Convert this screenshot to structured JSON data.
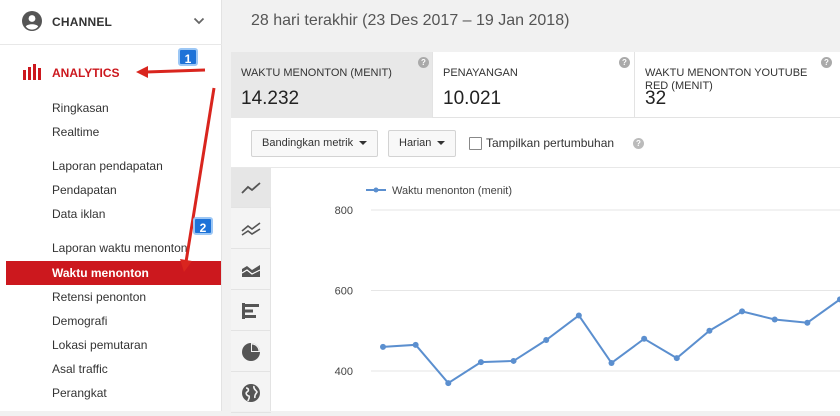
{
  "sidebar": {
    "channel_label": "CHANNEL",
    "analytics_label": "ANALYTICS",
    "items": [
      {
        "label": "Ringkasan"
      },
      {
        "label": "Realtime"
      },
      {
        "label": "Laporan pendapatan"
      },
      {
        "label": "Pendapatan"
      },
      {
        "label": "Data iklan"
      },
      {
        "label": "Laporan waktu menonton"
      },
      {
        "label": "Waktu menonton",
        "active": true
      },
      {
        "label": "Retensi penonton"
      },
      {
        "label": "Demografi"
      },
      {
        "label": "Lokasi pemutaran"
      },
      {
        "label": "Asal traffic"
      },
      {
        "label": "Perangkat"
      }
    ]
  },
  "header": {
    "date_range": "28 hari terakhir (23 Des 2017 – 19 Jan 2018)"
  },
  "metrics": [
    {
      "label": "WAKTU MENONTON (MENIT)",
      "value": "14.232",
      "help": "?"
    },
    {
      "label": "PENAYANGAN",
      "value": "10.021",
      "help": "?"
    },
    {
      "label": "WAKTU MENONTON YOUTUBE RED (MENIT)",
      "value": "32",
      "help": "?"
    }
  ],
  "toolbar": {
    "compare_label": "Bandingkan metrik",
    "period_label": "Harian",
    "growth_label": "Tampilkan pertumbuhan",
    "growth_checked": false,
    "help": "?"
  },
  "chart_types": [
    "line-chart-icon",
    "multi-line-chart-icon",
    "area-chart-icon",
    "bar-chart-icon",
    "pie-chart-icon",
    "globe-icon"
  ],
  "annotations": {
    "badge1": "1",
    "badge2": "2"
  },
  "colors": {
    "accent_red": "#cc181e",
    "line_blue": "#5b8fcf",
    "badge_blue": "#1e73d8",
    "arrow_red": "#d9251e"
  },
  "chart_data": {
    "type": "line",
    "legend": "Waktu menonton (menit)",
    "ytick_labels": [
      "800",
      "600",
      "400"
    ],
    "yticks": [
      800,
      600,
      400
    ],
    "series": [
      {
        "name": "Waktu menonton (menit)",
        "values": [
          460,
          465,
          370,
          422,
          425,
          477,
          538,
          420,
          480,
          432,
          500,
          548,
          528,
          520,
          578
        ]
      }
    ]
  }
}
